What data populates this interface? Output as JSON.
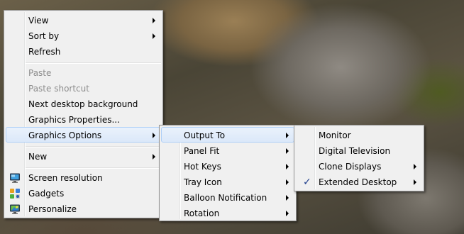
{
  "main_menu": {
    "items": [
      {
        "label": "View",
        "submenu": true
      },
      {
        "label": "Sort by",
        "submenu": true
      },
      {
        "label": "Refresh"
      },
      {
        "label": "Paste",
        "disabled": true
      },
      {
        "label": "Paste shortcut",
        "disabled": true
      },
      {
        "label": "Next desktop background"
      },
      {
        "label": "Graphics Properties..."
      },
      {
        "label": "Graphics Options",
        "submenu": true,
        "highlighted": true
      },
      {
        "label": "New",
        "submenu": true
      },
      {
        "label": "Screen resolution",
        "icon": "monitor-icon"
      },
      {
        "label": "Gadgets",
        "icon": "gadgets-icon"
      },
      {
        "label": "Personalize",
        "icon": "personalize-icon"
      }
    ]
  },
  "graphics_options_menu": {
    "items": [
      {
        "label": "Output To",
        "submenu": true,
        "highlighted": true
      },
      {
        "label": "Panel Fit",
        "submenu": true
      },
      {
        "label": "Hot Keys",
        "submenu": true
      },
      {
        "label": "Tray Icon",
        "submenu": true
      },
      {
        "label": "Balloon Notification",
        "submenu": true
      },
      {
        "label": "Rotation",
        "submenu": true
      }
    ]
  },
  "output_to_menu": {
    "items": [
      {
        "label": "Monitor"
      },
      {
        "label": "Digital Television"
      },
      {
        "label": "Clone Displays",
        "submenu": true
      },
      {
        "label": "Extended Desktop",
        "submenu": true,
        "checked": true,
        "check_glyph": "✓"
      }
    ]
  },
  "colors": {
    "menu_background": "#f0f0f0",
    "highlight_border": "#aecff7",
    "highlight_fill": "#dbe8f9",
    "disabled_text": "#8d8d8d",
    "check_mark": "#1e3e8c"
  }
}
